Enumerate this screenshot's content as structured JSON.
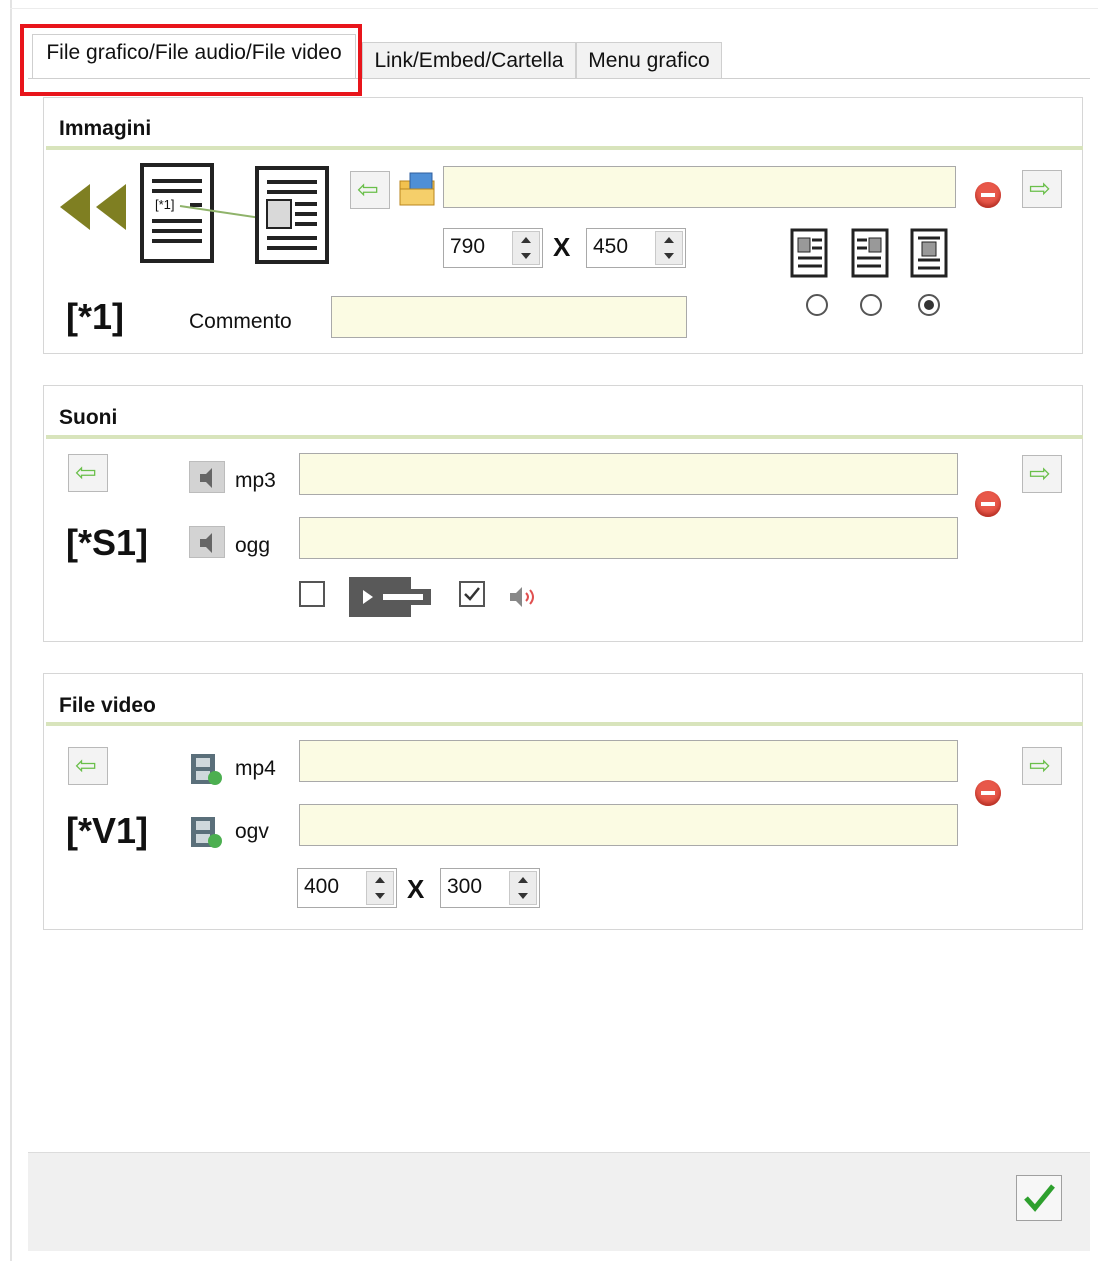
{
  "tabs": [
    {
      "label": "File grafico/File audio/File video",
      "active": true
    },
    {
      "label": "Link/Embed/Cartella",
      "active": false
    },
    {
      "label": "Menu grafico",
      "active": false
    }
  ],
  "images": {
    "title": "Immagini",
    "tag": "[*1]",
    "preview_marker": "[*1]",
    "width": "790",
    "height": "450",
    "times": "X",
    "comment_label": "Commento",
    "file_value": "",
    "comment_value": "",
    "alignment_selected": 3
  },
  "sounds": {
    "title": "Suoni",
    "tag": "[*S1]",
    "mp3_label": "mp3",
    "ogg_label": "ogg",
    "mp3_value": "",
    "ogg_value": "",
    "loop_checked": false,
    "autoplay_checked": true
  },
  "video": {
    "title": "File video",
    "tag": "[*V1]",
    "mp4_label": "mp4",
    "ogv_label": "ogv",
    "mp4_value": "",
    "ogv_value": "",
    "width": "400",
    "height": "300",
    "times": "X"
  },
  "colors": {
    "field_bg": "#fbfbe3",
    "rule": "#d8e4bc",
    "highlight": "#e8151b",
    "ok_check": "#2ea02e"
  }
}
